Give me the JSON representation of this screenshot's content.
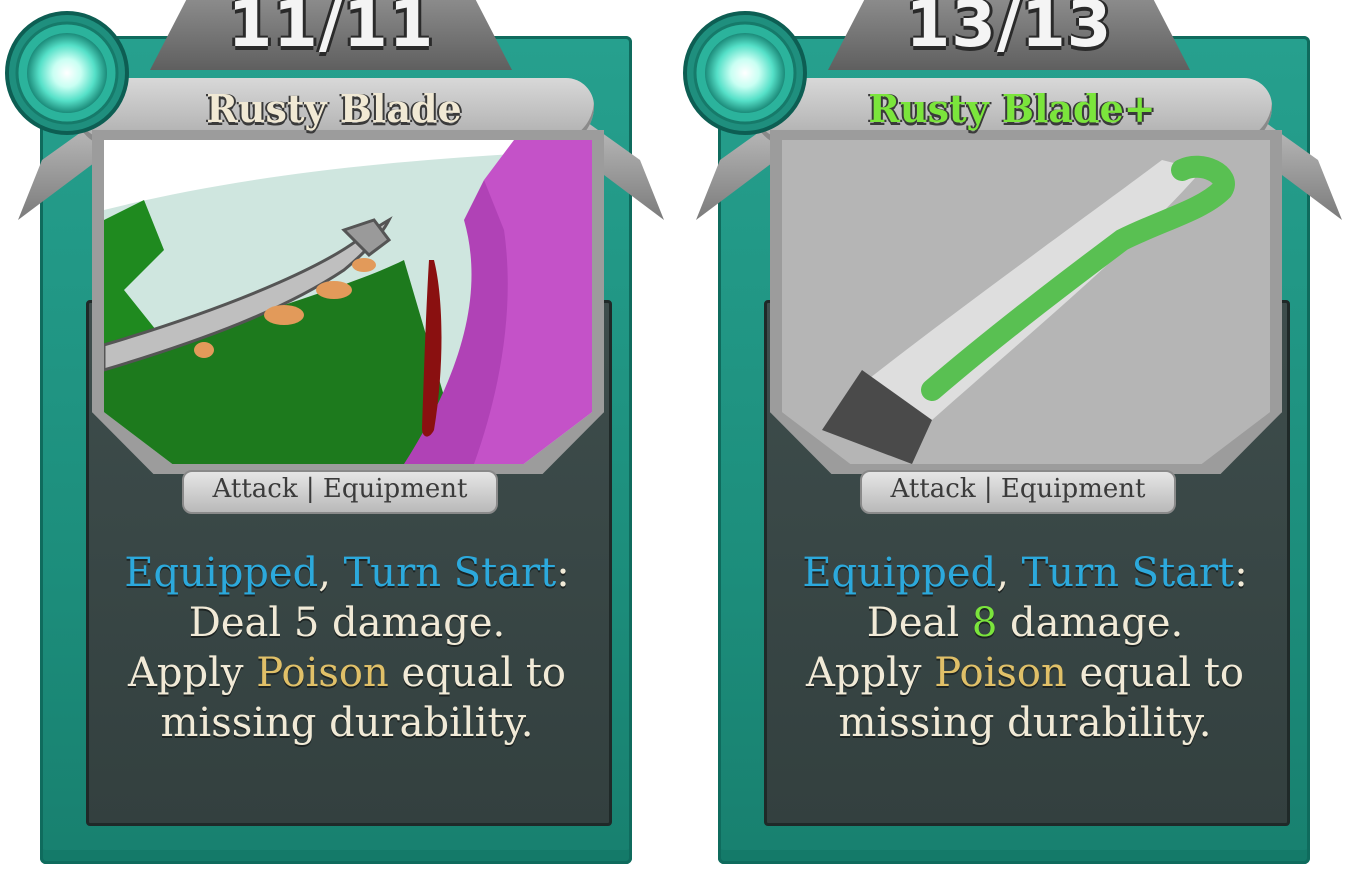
{
  "cards": [
    {
      "durability": "11/11",
      "title": "Rusty Blade",
      "type_line": "Attack | Equipment",
      "desc": {
        "kw1": "Equipped",
        "sep": ", ",
        "kw2": "Turn Start",
        "colon": ":",
        "deal_pre": "Deal ",
        "damage": "5",
        "deal_post": " damage.",
        "apply_pre": "Apply ",
        "poison": "Poison",
        "apply_post": " equal to",
        "line4": "missing durability."
      }
    },
    {
      "durability": "13/13",
      "title": "Rusty Blade+",
      "type_line": "Attack | Equipment",
      "desc": {
        "kw1": "Equipped",
        "sep": ", ",
        "kw2": "Turn Start",
        "colon": ":",
        "deal_pre": "Deal ",
        "damage": "8",
        "deal_post": " damage.",
        "apply_pre": "Apply ",
        "poison": "Poison",
        "apply_post": " equal to",
        "line4": "missing durability."
      }
    }
  ],
  "colors": {
    "frame": "#1d8f7d",
    "panel": "#3a4847",
    "keyword_blue": "#2ca9dc",
    "keyword_gold": "#e0c068",
    "upgrade_green": "#7be53c"
  },
  "icons": {
    "energy_orb": "energy-orb-icon"
  }
}
